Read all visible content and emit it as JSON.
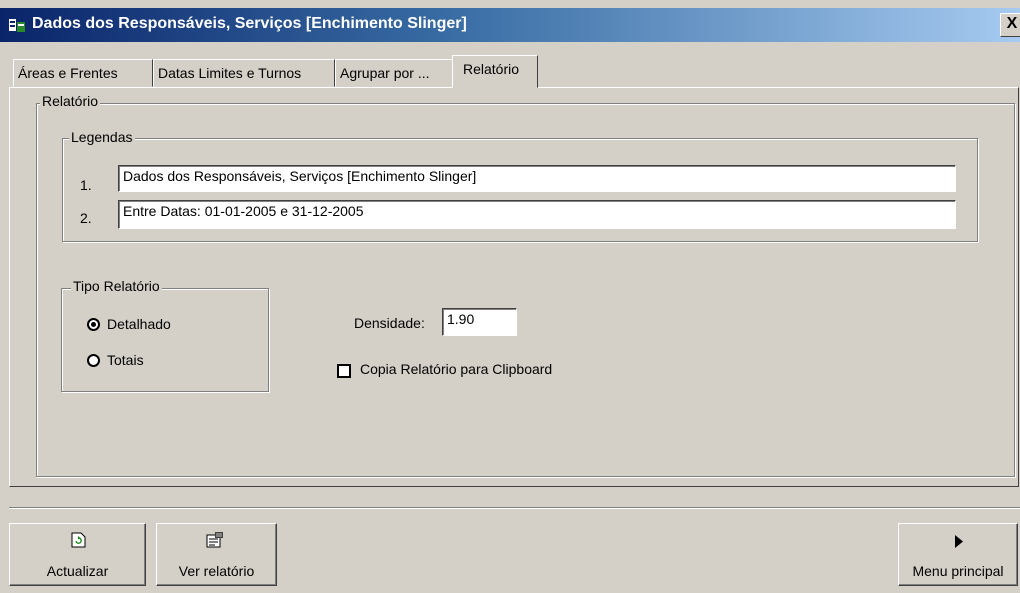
{
  "window": {
    "title": "Dados dos Responsáveis, Serviços [Enchimento Slinger]",
    "close_label": "X"
  },
  "tabs": [
    {
      "label": "Áreas e Frentes",
      "active": false
    },
    {
      "label": "Datas Limites e Turnos",
      "active": false
    },
    {
      "label": "Agrupar por ...",
      "active": false
    },
    {
      "label": "Relatório",
      "active": true
    }
  ],
  "report": {
    "group_label": "Relatório",
    "legends": {
      "group_label": "Legendas",
      "items": [
        {
          "num": "1.",
          "value": "Dados dos Responsáveis, Serviços [Enchimento Slinger]"
        },
        {
          "num": "2.",
          "value": "Entre Datas: 01-01-2005 e 31-12-2005"
        }
      ]
    },
    "tipo": {
      "group_label": "Tipo Relatório",
      "options": [
        {
          "label": "Detalhado",
          "checked": true
        },
        {
          "label": "Totais",
          "checked": false
        }
      ]
    },
    "densidade": {
      "label": "Densidade:",
      "value": "1.90"
    },
    "clipboard": {
      "label": "Copia Relatório para Clipboard",
      "checked": false
    }
  },
  "buttons": {
    "actualizar": "Actualizar",
    "ver_relatorio": "Ver relatório",
    "menu_principal": "Menu principal"
  },
  "colors": {
    "face": "#d4d0c8",
    "titlebar_start": "#0a246a",
    "titlebar_end": "#a6caf0"
  }
}
